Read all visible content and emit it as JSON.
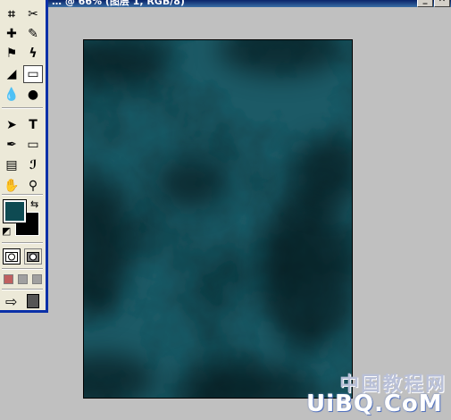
{
  "window": {
    "title": "… @ 66% (图层 1, RGB/8)",
    "minimize_glyph": "_",
    "close_glyph": "✕"
  },
  "toolbox": {
    "tools": [
      {
        "name": "crop-tool",
        "glyph": "⌗"
      },
      {
        "name": "slice-tool",
        "glyph": "✂"
      },
      {
        "name": "healing-brush-tool",
        "glyph": "✚"
      },
      {
        "name": "brush-tool",
        "glyph": "✎"
      },
      {
        "name": "clone-stamp-tool",
        "glyph": "⚑"
      },
      {
        "name": "history-brush-tool",
        "glyph": "ϟ"
      },
      {
        "name": "eraser-tool",
        "glyph": "◢"
      },
      {
        "name": "gradient-tool",
        "glyph": "▭"
      },
      {
        "name": "blur-tool",
        "glyph": "💧"
      },
      {
        "name": "dodge-tool",
        "glyph": "●"
      },
      {
        "name": "path-selection-tool",
        "glyph": "➤"
      },
      {
        "name": "type-tool",
        "glyph": "T"
      },
      {
        "name": "pen-tool",
        "glyph": "✒"
      },
      {
        "name": "rectangle-tool",
        "glyph": "▭"
      },
      {
        "name": "notes-tool",
        "glyph": "▤"
      },
      {
        "name": "eyedropper-tool",
        "glyph": "ℐ"
      },
      {
        "name": "hand-tool",
        "glyph": "✋"
      },
      {
        "name": "zoom-tool",
        "glyph": "⚲"
      }
    ],
    "foreground_color": "#0e4a52",
    "background_color": "#000000",
    "swap_glyph": "⇆",
    "default_glyph": "◩",
    "jump_to_glyph": "⇨"
  },
  "canvas": {
    "base_color": "#0d3a42",
    "dark_color": "#010a0c",
    "light_color": "#1a5a66"
  },
  "watermark": {
    "cn_text": "中国教程网",
    "en_text": "UiBQ.CoM"
  }
}
